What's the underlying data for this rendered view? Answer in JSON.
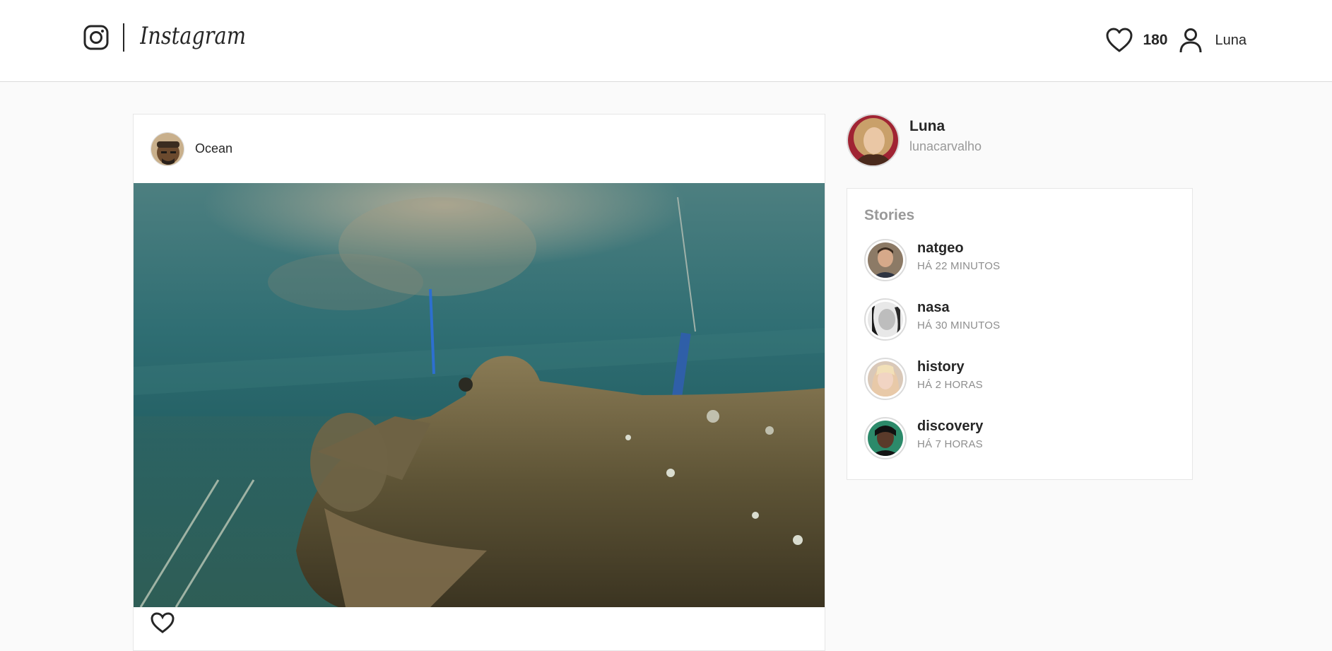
{
  "header": {
    "logo_icon": "instagram-camera-icon",
    "wordmark": "Instagram",
    "likes_icon": "heart-icon",
    "likes_count": "180",
    "profile_icon": "user-icon",
    "profile_name": "Luna"
  },
  "post": {
    "author": "Ocean",
    "image_subject": "underwater shipwreck submarine",
    "action_icon": "heart-icon"
  },
  "me": {
    "name": "Luna",
    "username": "lunacarvalho"
  },
  "stories": {
    "title": "Stories",
    "items": [
      {
        "name": "natgeo",
        "time": "HÁ 22 MINUTOS"
      },
      {
        "name": "nasa",
        "time": "HÁ 30 MINUTOS"
      },
      {
        "name": "history",
        "time": "HÁ 2 HORAS"
      },
      {
        "name": "discovery",
        "time": "HÁ 7 HORAS"
      }
    ]
  },
  "colors": {
    "background": "#fafafa",
    "card": "#ffffff",
    "border": "#dbdbdb",
    "text": "#262626",
    "muted": "#8e8e8e"
  }
}
